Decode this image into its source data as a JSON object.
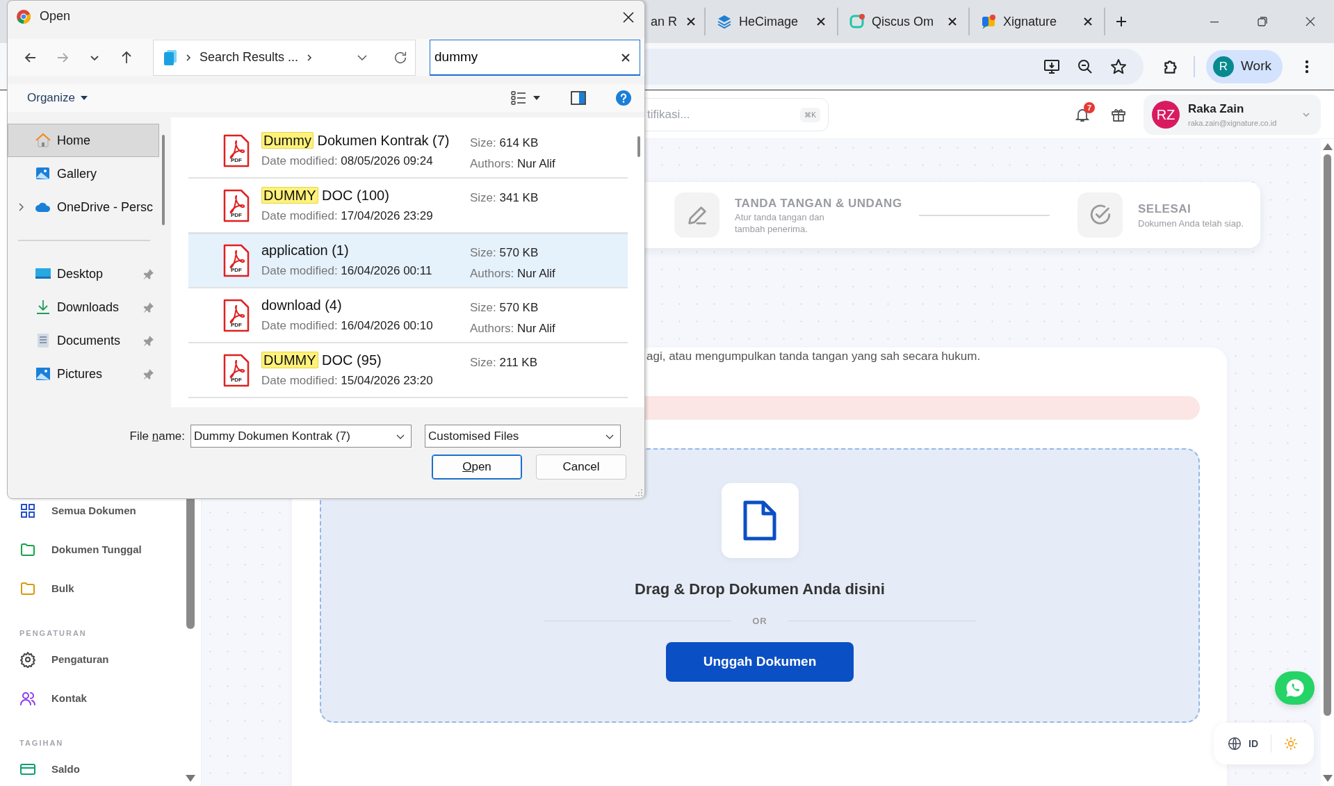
{
  "browser": {
    "tabs": [
      {
        "label": "an R"
      },
      {
        "label": "HeCimage"
      },
      {
        "label": "Qiscus Om"
      },
      {
        "label": "Xignature"
      }
    ],
    "profile": {
      "initial": "R",
      "label": "Work"
    }
  },
  "app": {
    "search": {
      "placeholder": "tifikasi...",
      "shortcut": "⌘K"
    },
    "notifications": "7",
    "user": {
      "initials": "RZ",
      "name": "Raka Zain",
      "email": "raka.zain@xignature.co.id"
    },
    "sidebar": [
      {
        "items": [
          {
            "label": "Semua Dokumen",
            "kind": "grid",
            "color": "#2450c8"
          },
          {
            "label": "Dokumen Tunggal",
            "kind": "folder",
            "color": "#16a34a"
          },
          {
            "label": "Bulk",
            "kind": "folder",
            "color": "#d99a0b"
          }
        ]
      },
      {
        "heading": "PENGATURAN",
        "items": [
          {
            "label": "Pengaturan",
            "kind": "gear",
            "color": "#444444"
          },
          {
            "label": "Kontak",
            "kind": "users",
            "color": "#8b3cf0"
          }
        ]
      },
      {
        "heading": "TAGIHAN",
        "items": [
          {
            "label": "Saldo",
            "kind": "card",
            "color": "#0d9f6e"
          }
        ]
      }
    ],
    "steps": [
      {
        "title": "TANDA TANGAN & UNDANG",
        "subtitle": "Atur tanda tangan dan tambah penerima.",
        "kind": "pen"
      },
      {
        "title": "SELESAI",
        "subtitle": "Dokumen Anda telah siap.",
        "kind": "check"
      }
    ],
    "intro": "agi, atau mengumpulkan tanda tangan yang sah secara hukum.",
    "dropzone": {
      "title": "Drag & Drop Dokumen Anda disini",
      "separator": "OR",
      "button": "Unggah Dokumen"
    },
    "language": "ID"
  },
  "dialog": {
    "title": "Open",
    "breadcrumb": "Search Results ...",
    "search": "dummy",
    "organize": "Organize",
    "nav_groups": [
      [
        {
          "label": "Home",
          "kind": "home",
          "selected": true,
          "pinned": false,
          "expandable": false
        },
        {
          "label": "Gallery",
          "kind": "gallery",
          "selected": false,
          "pinned": false,
          "expandable": false
        },
        {
          "label": "OneDrive - Persc",
          "kind": "cloud",
          "selected": false,
          "pinned": false,
          "expandable": true
        }
      ],
      [
        {
          "label": "Desktop",
          "kind": "desktop",
          "selected": false,
          "pinned": true,
          "expandable": false
        },
        {
          "label": "Downloads",
          "kind": "download",
          "selected": false,
          "pinned": true,
          "expandable": false
        },
        {
          "label": "Documents",
          "kind": "document",
          "selected": false,
          "pinned": true,
          "expandable": false
        },
        {
          "label": "Pictures",
          "kind": "picture",
          "selected": false,
          "pinned": true,
          "expandable": false
        }
      ]
    ],
    "files": [
      {
        "match": "Dummy",
        "rest": "Dokumen Kontrak (7)",
        "type": "PDF",
        "date_label": "Date modified:",
        "date": "08/05/2026 09:24",
        "size_label": "Size:",
        "size": "614 KB",
        "authors_label": "Authors:",
        "authors": "Nur Alif",
        "selected": false
      },
      {
        "match": "DUMMY",
        "rest": "DOC (100)",
        "type": "PDF",
        "date_label": "Date modified:",
        "date": "17/04/2026 23:29",
        "size_label": "Size:",
        "size": "341 KB",
        "selected": false
      },
      {
        "rest": "application (1)",
        "type": "PDF",
        "date_label": "Date modified:",
        "date": "16/04/2026 00:11",
        "size_label": "Size:",
        "size": "570 KB",
        "authors_label": "Authors:",
        "authors": "Nur Alif",
        "selected": true
      },
      {
        "rest": "download (4)",
        "type": "PDF",
        "date_label": "Date modified:",
        "date": "16/04/2026 00:10",
        "size_label": "Size:",
        "size": "570 KB",
        "authors_label": "Authors:",
        "authors": "Nur Alif",
        "selected": false
      },
      {
        "match": "DUMMY",
        "rest": "DOC (95)",
        "type": "PDF",
        "date_label": "Date modified:",
        "date": "15/04/2026 23:20",
        "size_label": "Size:",
        "size": "211 KB",
        "selected": false
      }
    ],
    "filename_label": [
      {
        "text": "File ",
        "underline": false
      },
      {
        "text": "n",
        "underline": true
      },
      {
        "text": "ame:",
        "underline": false
      }
    ],
    "filename": "Dummy Dokumen Kontrak (7)",
    "filetype": "Customised Files",
    "buttons": [
      {
        "kind": "default",
        "parts": [
          {
            "text": "O",
            "underline": true
          },
          {
            "text": "pen",
            "underline": false
          }
        ]
      },
      {
        "kind": "normal",
        "parts": [
          {
            "text": "Cancel",
            "underline": false
          }
        ]
      }
    ]
  }
}
